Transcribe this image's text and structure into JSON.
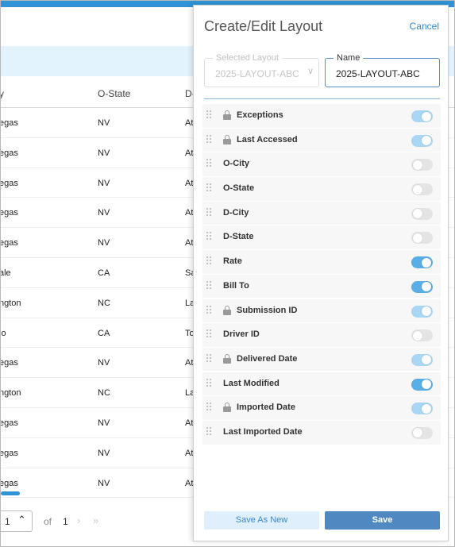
{
  "table": {
    "headers": {
      "city": "y",
      "o_state": "O-State",
      "d_city": "D-"
    },
    "rows": [
      {
        "city": "egas",
        "o_state": "NV",
        "d_city": "At"
      },
      {
        "city": "egas",
        "o_state": "NV",
        "d_city": "At"
      },
      {
        "city": "egas",
        "o_state": "NV",
        "d_city": "At"
      },
      {
        "city": "egas",
        "o_state": "NV",
        "d_city": "At"
      },
      {
        "city": "egas",
        "o_state": "NV",
        "d_city": "At"
      },
      {
        "city": "ale",
        "o_state": "CA",
        "d_city": "Sa"
      },
      {
        "city": "ngton",
        "o_state": "NC",
        "d_city": "La"
      },
      {
        "city": "io",
        "o_state": "CA",
        "d_city": "To"
      },
      {
        "city": "egas",
        "o_state": "NV",
        "d_city": "At"
      },
      {
        "city": "ngton",
        "o_state": "NC",
        "d_city": "La"
      },
      {
        "city": "egas",
        "o_state": "NV",
        "d_city": "At"
      },
      {
        "city": "egas",
        "o_state": "NV",
        "d_city": "At"
      },
      {
        "city": "egas",
        "o_state": "NV",
        "d_city": "At"
      }
    ]
  },
  "pager": {
    "page_size": "1",
    "of_label": "of",
    "total_pages": "1",
    "next_icon": "chevron-right-icon",
    "last_icon": "double-chevron-right-icon"
  },
  "panel": {
    "title": "Create/Edit Layout",
    "cancel_label": "Cancel",
    "selected_layout": {
      "label": "Selected Layout",
      "value": "2025-LAYOUT-ABC"
    },
    "name_field": {
      "label": "Name",
      "value": "2025-LAYOUT-ABC"
    },
    "fields": [
      {
        "label": "Exceptions",
        "locked": true,
        "enabled": true
      },
      {
        "label": "Last Accessed",
        "locked": true,
        "enabled": true
      },
      {
        "label": "O-City",
        "locked": false,
        "enabled": false
      },
      {
        "label": "O-State",
        "locked": false,
        "enabled": false
      },
      {
        "label": "D-City",
        "locked": false,
        "enabled": false
      },
      {
        "label": "D-State",
        "locked": false,
        "enabled": false
      },
      {
        "label": "Rate",
        "locked": false,
        "enabled": true
      },
      {
        "label": "Bill To",
        "locked": false,
        "enabled": true
      },
      {
        "label": "Submission ID",
        "locked": true,
        "enabled": true
      },
      {
        "label": "Driver ID",
        "locked": false,
        "enabled": false
      },
      {
        "label": "Delivered Date",
        "locked": true,
        "enabled": true
      },
      {
        "label": "Last Modified",
        "locked": false,
        "enabled": true
      },
      {
        "label": "Imported Date",
        "locked": true,
        "enabled": true
      },
      {
        "label": "Last Imported Date",
        "locked": false,
        "enabled": false
      }
    ],
    "save_as_new_label": "Save As New",
    "save_label": "Save"
  },
  "colors": {
    "accent": "#2f93d6",
    "toggle_on": "#5aaee6",
    "toggle_locked_on": "#a9d6f2",
    "save_button": "#5089c2"
  }
}
